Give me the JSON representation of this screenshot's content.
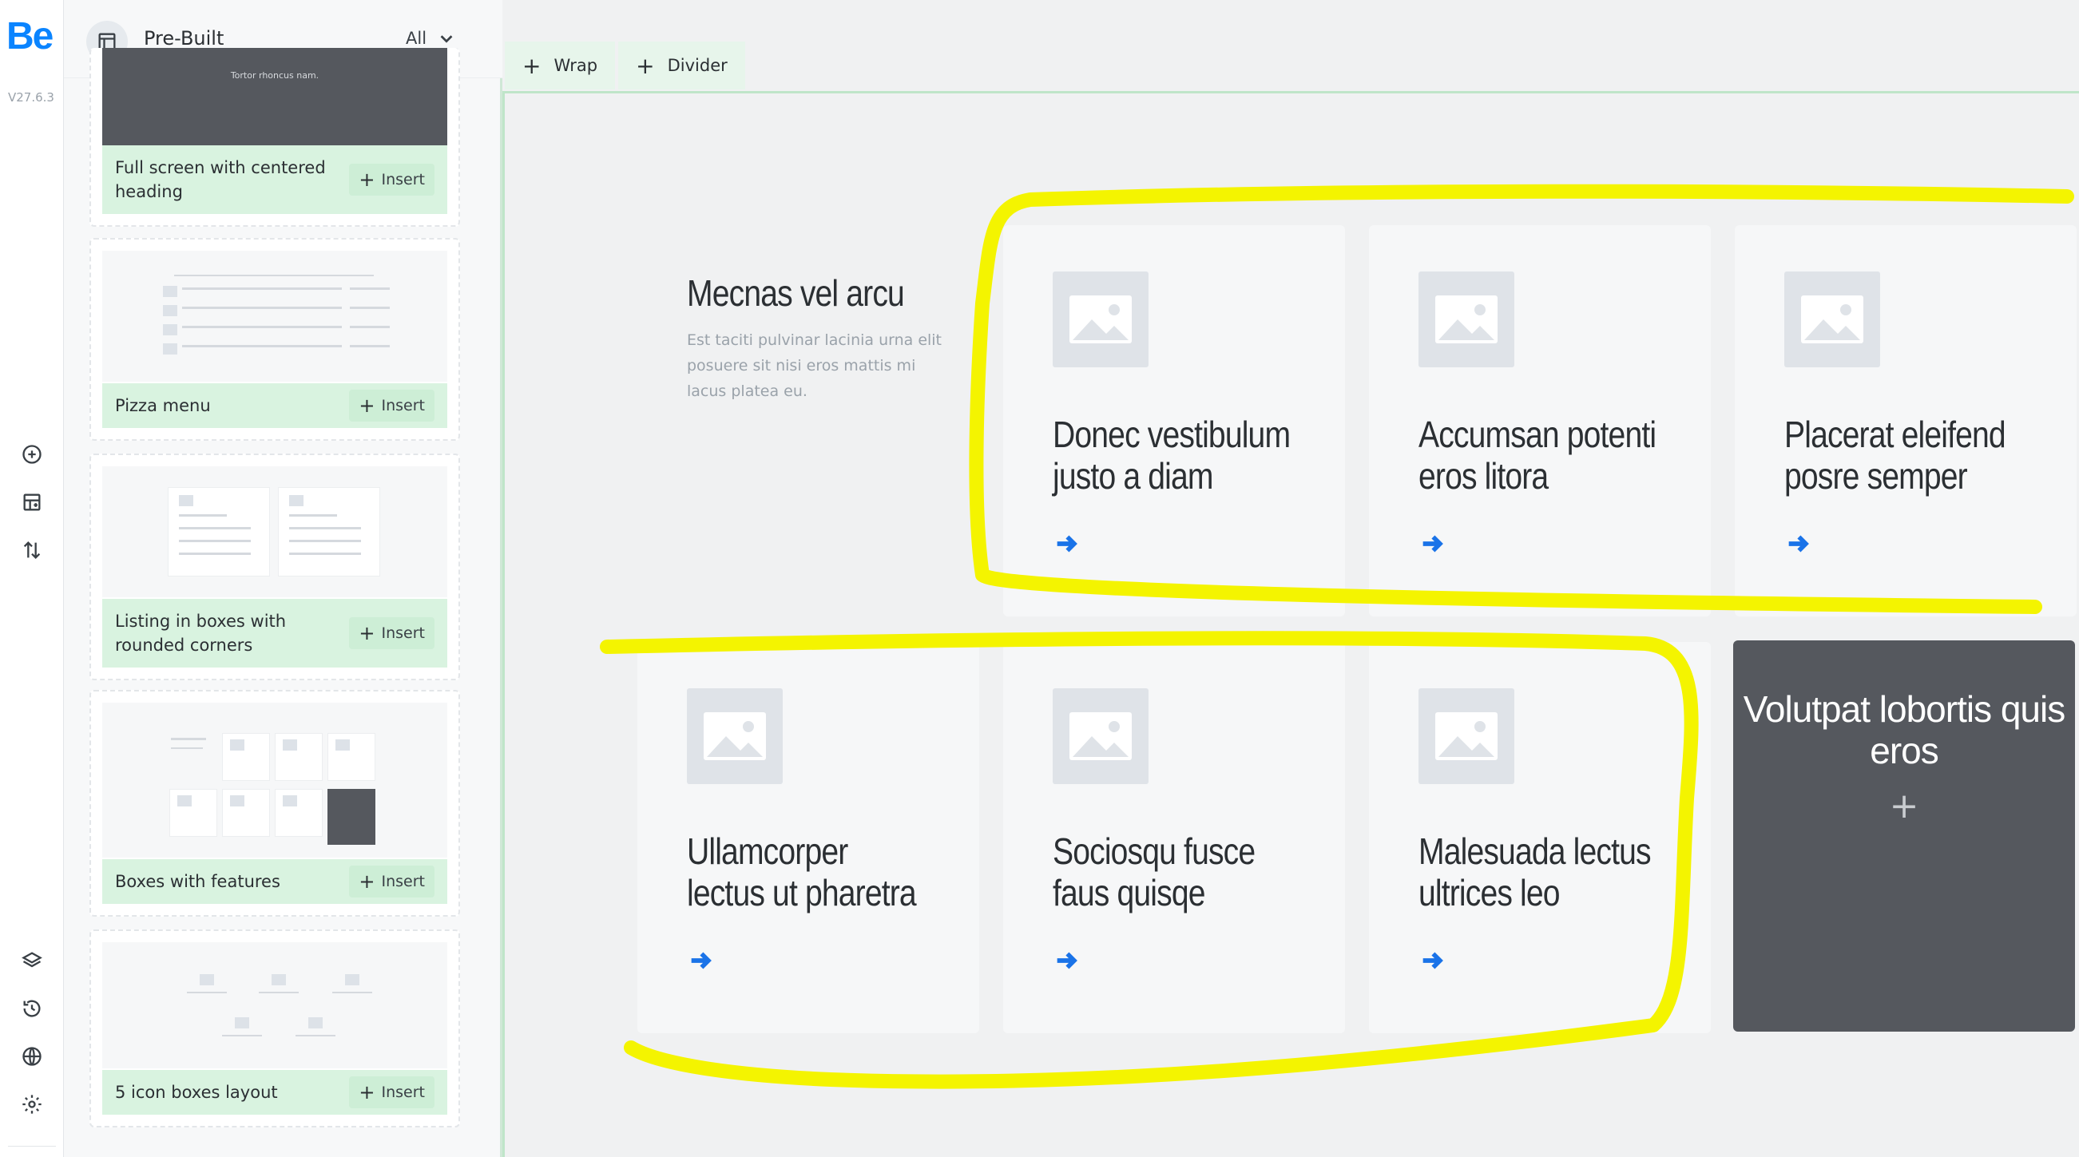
{
  "app": {
    "logo": "Be",
    "version": "V27.6.3"
  },
  "rail": {
    "icons": [
      "add-element-icon",
      "layout-icon",
      "sort-icon",
      "layers-icon",
      "history-icon",
      "globe-icon",
      "settings-icon"
    ]
  },
  "library": {
    "title": "Pre-Built",
    "filter": "All",
    "insert_label": "Insert",
    "cards": [
      {
        "name": "Full screen with centered heading",
        "thumb_text": "Tortor rhoncus nam."
      },
      {
        "name": "Pizza menu"
      },
      {
        "name": "Listing in boxes with rounded corners"
      },
      {
        "name": "Boxes with features"
      },
      {
        "name": "5 icon boxes layout"
      }
    ]
  },
  "toolbar": {
    "wrap_label": "Wrap",
    "divider_label": "Divider"
  },
  "canvas": {
    "intro_title": "Mecnas vel arcu",
    "intro_text": "Est taciti pulvinar lacinia urna elit posuere sit nisi eros mattis mi lacus platea eu.",
    "features": [
      {
        "title": "Donec vestibulum justo a diam"
      },
      {
        "title": "Accumsan potenti eros litora"
      },
      {
        "title": "Placerat eleifend posre semper"
      },
      {
        "title": "Ullamcorper lectus ut pharetra"
      },
      {
        "title": "Sociosqu fusce faus quisqe"
      },
      {
        "title": "Malesuada lectus ultrices leo"
      }
    ],
    "dark_box_title": "Volutpat lobortis quis eros",
    "dark_box_plus": "+"
  },
  "colors": {
    "accent": "#0a84ff",
    "insert_bg": "#d9f3e0",
    "arrow": "#1a73e8",
    "dark_box": "#55585e",
    "highlight": "#f4f400"
  }
}
